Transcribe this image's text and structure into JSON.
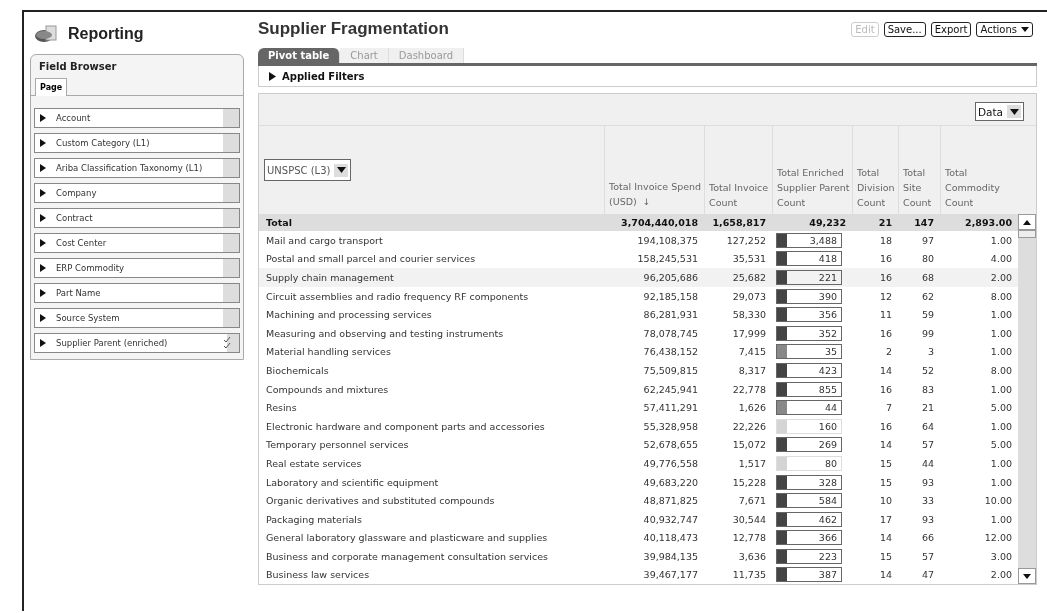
{
  "app": {
    "title": "Reporting"
  },
  "field_browser": {
    "title": "Field Browser",
    "tabs": [
      {
        "label": "Page",
        "selected": true
      }
    ],
    "items": [
      {
        "label": "Account",
        "checked": false
      },
      {
        "label": "Custom Category (L1)",
        "checked": false
      },
      {
        "label": "Ariba Classification Taxonomy (L1)",
        "checked": false
      },
      {
        "label": "Company",
        "checked": false
      },
      {
        "label": "Contract",
        "checked": false
      },
      {
        "label": "Cost Center",
        "checked": false
      },
      {
        "label": "ERP Commodity",
        "checked": false
      },
      {
        "label": "Part Name",
        "checked": false
      },
      {
        "label": "Source System",
        "checked": false
      },
      {
        "label": "Supplier Parent (enriched)",
        "checked": true
      }
    ]
  },
  "report": {
    "title": "Supplier Fragmentation",
    "buttons": [
      {
        "label": "Edit",
        "disabled": true,
        "caret": false
      },
      {
        "label": "Save...",
        "disabled": false,
        "caret": false
      },
      {
        "label": "Export",
        "disabled": false,
        "caret": false
      },
      {
        "label": "Actions",
        "disabled": false,
        "caret": true
      }
    ],
    "tabs": [
      {
        "label": "Pivot table",
        "selected": true
      },
      {
        "label": "Chart",
        "selected": false
      },
      {
        "label": "Dashboard",
        "selected": false
      }
    ],
    "applied_filters": {
      "label": "Applied Filters",
      "expanded": false
    },
    "data_dropdown": {
      "value": "Data"
    }
  },
  "table": {
    "dimension": {
      "value": "UNSPSC (L3)"
    },
    "columns": [
      {
        "label": "Total Invoice Spend (USD)",
        "sort_mark": "↓"
      },
      {
        "label": "Total Invoice Count"
      },
      {
        "label": "Total Enriched Supplier Parent Count"
      },
      {
        "label": "Total Division Count"
      },
      {
        "label": "Total Site Count"
      },
      {
        "label": "Total Commodity Count"
      }
    ],
    "total": {
      "label": "Total",
      "values": [
        "3,704,440,018",
        "1,658,817",
        "49,232",
        "21",
        "147",
        "2,893.00"
      ]
    },
    "rows": [
      {
        "name": "Mail and cargo transport",
        "selected": false,
        "color": "#444444",
        "values": [
          "194,108,375",
          "127,252",
          "3,488",
          "18",
          "97",
          "1.00"
        ]
      },
      {
        "name": "Postal and small parcel and courier services",
        "selected": false,
        "color": "#444444",
        "values": [
          "158,245,531",
          "35,531",
          "418",
          "16",
          "80",
          "4.00"
        ]
      },
      {
        "name": "Supply chain management",
        "selected": true,
        "color": "#444444",
        "values": [
          "96,205,686",
          "25,682",
          "221",
          "16",
          "68",
          "2.00"
        ]
      },
      {
        "name": "Circuit assemblies and radio frequency RF components",
        "selected": false,
        "color": "#444444",
        "values": [
          "92,185,158",
          "29,073",
          "390",
          "12",
          "62",
          "8.00"
        ]
      },
      {
        "name": "Machining and processing services",
        "selected": false,
        "color": "#444444",
        "values": [
          "86,281,931",
          "58,330",
          "356",
          "11",
          "59",
          "1.00"
        ]
      },
      {
        "name": "Measuring and observing and testing instruments",
        "selected": false,
        "color": "#444444",
        "values": [
          "78,078,745",
          "17,999",
          "352",
          "16",
          "99",
          "1.00"
        ]
      },
      {
        "name": "Material handling services",
        "selected": false,
        "color": "#888888",
        "values": [
          "76,438,152",
          "7,415",
          "35",
          "2",
          "3",
          "1.00"
        ]
      },
      {
        "name": "Biochemicals",
        "selected": false,
        "color": "#444444",
        "values": [
          "75,509,815",
          "8,317",
          "423",
          "14",
          "52",
          "8.00"
        ]
      },
      {
        "name": "Compounds and mixtures",
        "selected": false,
        "color": "#444444",
        "values": [
          "62,245,941",
          "22,778",
          "855",
          "16",
          "83",
          "1.00"
        ]
      },
      {
        "name": "Resins",
        "selected": false,
        "color": "#888888",
        "values": [
          "57,411,291",
          "1,626",
          "44",
          "7",
          "21",
          "5.00"
        ]
      },
      {
        "name": "Electronic hardware and component parts and accessories",
        "selected": false,
        "color": "#d4d4d4",
        "values": [
          "55,328,958",
          "22,226",
          "160",
          "16",
          "64",
          "1.00"
        ]
      },
      {
        "name": "Temporary personnel services",
        "selected": false,
        "color": "#444444",
        "values": [
          "52,678,655",
          "15,072",
          "269",
          "14",
          "57",
          "5.00"
        ]
      },
      {
        "name": "Real estate services",
        "selected": false,
        "color": "#d4d4d4",
        "values": [
          "49,776,558",
          "1,517",
          "80",
          "15",
          "44",
          "1.00"
        ]
      },
      {
        "name": "Laboratory and scientific equipment",
        "selected": false,
        "color": "#444444",
        "values": [
          "49,683,220",
          "15,228",
          "328",
          "15",
          "93",
          "1.00"
        ]
      },
      {
        "name": "Organic derivatives and substituted compounds",
        "selected": false,
        "color": "#444444",
        "values": [
          "48,871,825",
          "7,671",
          "584",
          "10",
          "33",
          "10.00"
        ]
      },
      {
        "name": "Packaging materials",
        "selected": false,
        "color": "#444444",
        "values": [
          "40,932,747",
          "30,544",
          "462",
          "17",
          "93",
          "1.00"
        ]
      },
      {
        "name": "General laboratory glassware and plasticware and supplies",
        "selected": false,
        "color": "#444444",
        "values": [
          "40,118,473",
          "12,778",
          "366",
          "14",
          "66",
          "12.00"
        ]
      },
      {
        "name": "Business and corporate management consultation services",
        "selected": false,
        "color": "#444444",
        "values": [
          "39,984,135",
          "3,636",
          "223",
          "15",
          "57",
          "3.00"
        ]
      },
      {
        "name": "Business law services",
        "selected": false,
        "color": "#444444",
        "values": [
          "39,467,177",
          "11,735",
          "387",
          "14",
          "47",
          "2.00"
        ]
      }
    ]
  }
}
